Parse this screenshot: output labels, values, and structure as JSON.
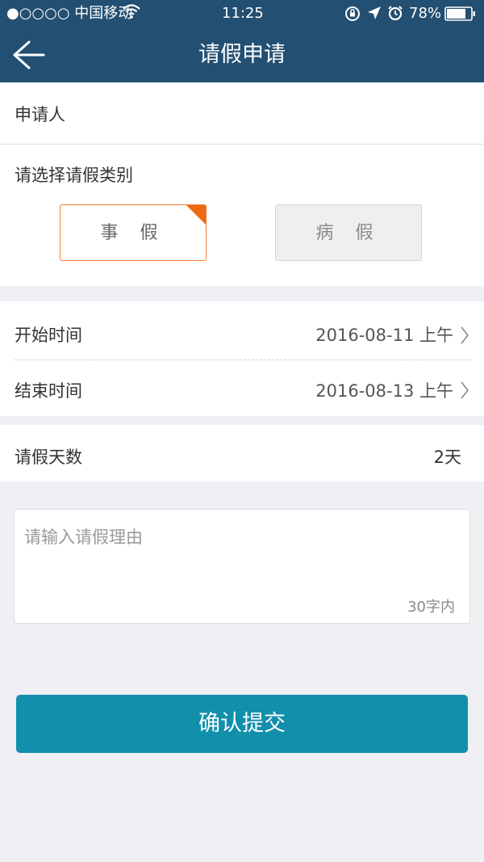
{
  "status_bar": {
    "carrier": "●○○○○ 中国移动",
    "time": "11:25",
    "battery": "78%",
    "icons": [
      "wifi-icon",
      "rotation-lock-icon",
      "location-arrow-icon",
      "alarm-icon",
      "battery-icon"
    ]
  },
  "nav": {
    "title": "请假申请",
    "back_icon": "back-arrow-icon"
  },
  "applicant": {
    "label": "申请人"
  },
  "leave_type": {
    "prompt": "请选择请假类别",
    "options": [
      {
        "label": "事 假",
        "selected": true
      },
      {
        "label": "病 假",
        "selected": false
      }
    ]
  },
  "time": {
    "start": {
      "label": "开始时间",
      "value": "2016-08-11 上午"
    },
    "end": {
      "label": "结束时间",
      "value": "2016-08-13 上午"
    }
  },
  "days": {
    "label": "请假天数",
    "value": "2天"
  },
  "reason": {
    "placeholder": "请输入请假理由",
    "limit": "30字内"
  },
  "submit": {
    "label": "确认提交"
  },
  "colors": {
    "header_bg": "#234f72",
    "accent_orange": "#ee6a12",
    "submit_bg": "#118fab",
    "page_bg": "#efeff4"
  }
}
